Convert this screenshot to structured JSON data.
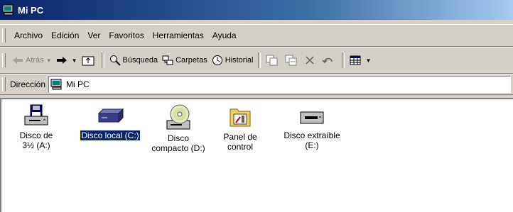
{
  "window": {
    "title": "Mi PC"
  },
  "menu": [
    "Archivo",
    "Edición",
    "Ver",
    "Favoritos",
    "Herramientas",
    "Ayuda"
  ],
  "toolbar": {
    "back": "Atrás",
    "search": "Búsqueda",
    "folders": "Carpetas",
    "history": "Historial"
  },
  "address": {
    "label": "Dirección",
    "value": "Mi PC"
  },
  "drives": [
    {
      "label": "Disco de 3½ (A:)",
      "icon": "floppy-drive-icon",
      "selected": false
    },
    {
      "label": "Disco local (C:)",
      "icon": "hard-disk-icon",
      "selected": true
    },
    {
      "label": "Disco compacto (D:)",
      "icon": "cd-drive-icon",
      "selected": false
    },
    {
      "label": "Panel de control",
      "icon": "control-panel-icon",
      "selected": false
    },
    {
      "label": "Disco extraíble (E:)",
      "icon": "removable-disk-icon",
      "selected": false
    }
  ],
  "colors": {
    "titlebar": "#0a246a",
    "selection": "#0a246a",
    "face": "#d4d0c8"
  }
}
